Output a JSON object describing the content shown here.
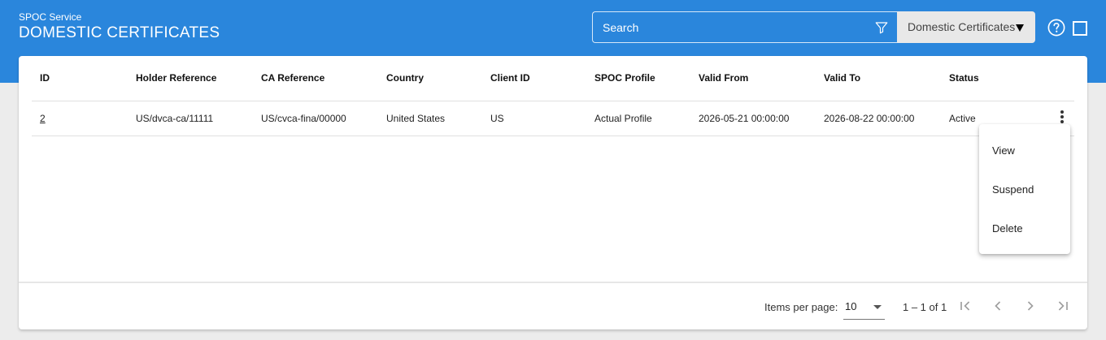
{
  "header": {
    "service": "SPOC Service",
    "title": "DOMESTIC CERTIFICATES"
  },
  "search": {
    "placeholder": "Search",
    "value": ""
  },
  "type_select": {
    "selected": "Domestic Certificates"
  },
  "icons": {
    "filter": "filter-icon",
    "help": "help-circle-icon",
    "square": "square-icon",
    "more": "more-vert-icon",
    "first_page": "first-page-icon",
    "prev_page": "chevron-left-icon",
    "next_page": "chevron-right-icon",
    "last_page": "last-page-icon"
  },
  "table": {
    "columns": [
      "ID",
      "Holder Reference",
      "CA Reference",
      "Country",
      "Client ID",
      "SPOC Profile",
      "Valid From",
      "Valid To",
      "Status"
    ],
    "rows": [
      [
        "2",
        "US/dvca-ca/11111",
        "US/cvca-fina/00000",
        "United States",
        "US",
        "Actual Profile",
        "2026-05-21 00:00:00",
        "2026-08-22 00:00:00",
        "Active"
      ]
    ]
  },
  "context_menu": {
    "items": [
      "View",
      "Suspend",
      "Delete"
    ]
  },
  "paginator": {
    "items_per_page_label": "Items per page:",
    "items_per_page": "10",
    "range": "1 – 1 of 1"
  },
  "colors": {
    "header_bg": "#2a86dc",
    "page_bg": "#ececec",
    "card_bg": "#ffffff",
    "select_bg": "#e8e8e8"
  }
}
